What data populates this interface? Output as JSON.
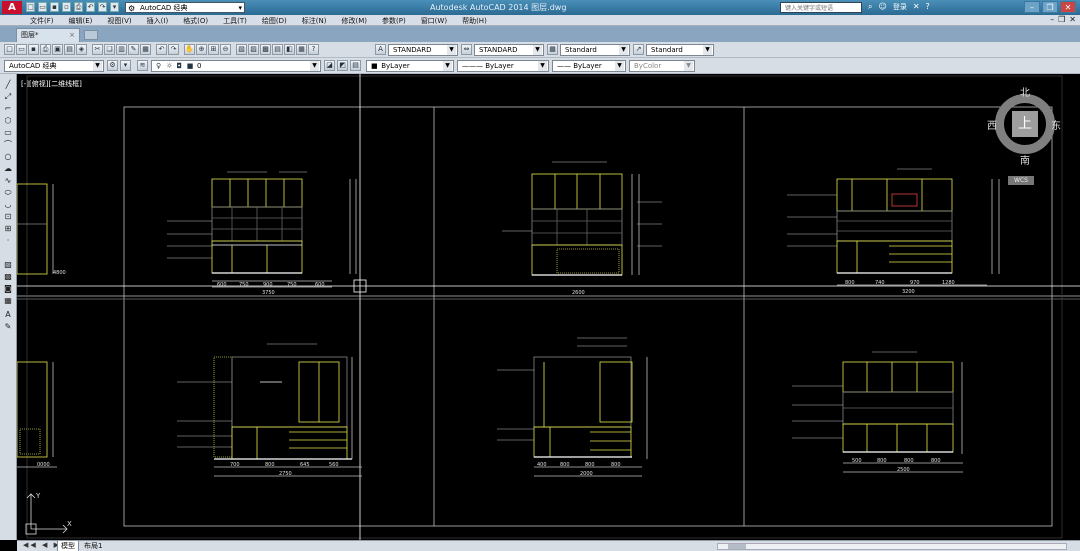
{
  "app": {
    "title": "Autodesk AutoCAD 2014    图层.dwg",
    "logo": "A",
    "workspace": "AutoCAD 经典",
    "search_placeholder": "键入关键字或短语",
    "login": "登录"
  },
  "menu": [
    "文件(F)",
    "编辑(E)",
    "视图(V)",
    "插入(I)",
    "格式(O)",
    "工具(T)",
    "绘图(D)",
    "标注(N)",
    "修改(M)",
    "参数(P)",
    "窗口(W)",
    "帮助(H)"
  ],
  "document_tab": {
    "label": "图层*",
    "close": "×"
  },
  "toolbar2": {
    "workspace": "AutoCAD 经典",
    "layer": "0",
    "color": "ByLayer",
    "linetype": "ByLayer",
    "lineweight": "ByLayer",
    "plotstyle": "ByColor"
  },
  "styles": {
    "text_style": "STANDARD",
    "dim_style": "STANDARD",
    "table_style": "Standard",
    "mleader_style": "Standard"
  },
  "viewport_label": "[-][俯视][二维线框]",
  "viewcube": {
    "face": "上",
    "north": "北",
    "south": "南",
    "east": "东",
    "west": "西",
    "wcs": "WCS"
  },
  "layout_tabs": {
    "model": "模型",
    "layout1": "布局1"
  },
  "drawing": {
    "dims_top": {
      "p1": [
        "600",
        "750",
        "900",
        "750",
        "600"
      ],
      "p2": [
        "2600"
      ],
      "p3": [
        "800",
        "740",
        "970",
        "1280"
      ]
    },
    "dims_bottom": {
      "p1": [
        "700",
        "800",
        "645",
        "560"
      ],
      "p2": [
        "400",
        "800",
        "800",
        "800"
      ],
      "p3": [
        "500",
        "800",
        "800",
        "800"
      ]
    },
    "totals": {
      "p1_top": "3750",
      "p3_top": "3200",
      "p1_bot": "2750",
      "p2_bot": "2000",
      "p3_bot": "2500",
      "left_top": "4800",
      "left_bot": "0000"
    }
  }
}
